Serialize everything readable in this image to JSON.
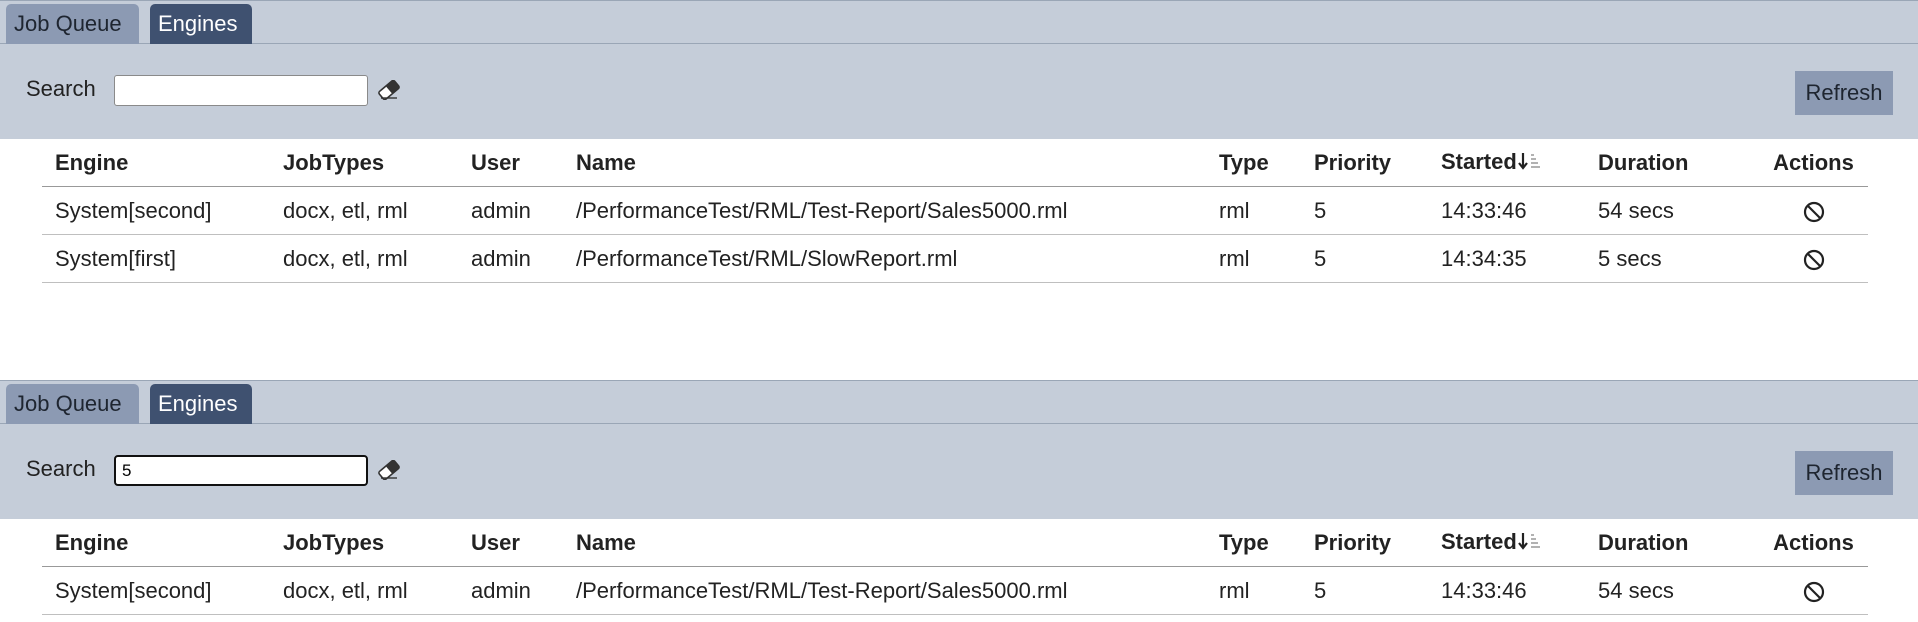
{
  "panels": [
    {
      "tabs": {
        "job_queue": "Job Queue",
        "engines": "Engines"
      },
      "search": {
        "label": "Search",
        "value": ""
      },
      "refresh_label": "Refresh",
      "columns": [
        "Engine",
        "JobTypes",
        "User",
        "Name",
        "Type",
        "Priority",
        "Started",
        "Duration",
        "Actions"
      ],
      "rows": [
        {
          "engine": "System[second]",
          "jobtypes": "docx, etl, rml",
          "user": "admin",
          "name": "/PerformanceTest/RML/Test-Report/Sales5000.rml",
          "type": "rml",
          "priority": "5",
          "started": "14:33:46",
          "duration": "54 secs"
        },
        {
          "engine": "System[first]",
          "jobtypes": "docx, etl, rml",
          "user": "admin",
          "name": "/PerformanceTest/RML/SlowReport.rml",
          "type": "rml",
          "priority": "5",
          "started": "14:34:35",
          "duration": "5 secs"
        }
      ]
    },
    {
      "tabs": {
        "job_queue": "Job Queue",
        "engines": "Engines"
      },
      "search": {
        "label": "Search",
        "value": "5"
      },
      "refresh_label": "Refresh",
      "columns": [
        "Engine",
        "JobTypes",
        "User",
        "Name",
        "Type",
        "Priority",
        "Started",
        "Duration",
        "Actions"
      ],
      "rows": [
        {
          "engine": "System[second]",
          "jobtypes": "docx, etl, rml",
          "user": "admin",
          "name": "/PerformanceTest/RML/Test-Report/Sales5000.rml",
          "type": "rml",
          "priority": "5",
          "started": "14:33:46",
          "duration": "54 secs"
        }
      ]
    }
  ],
  "icons": {
    "clear": "eraser-icon",
    "sort": "sort-descending-icon",
    "cancel": "cancel-job-icon"
  },
  "colors": {
    "panel_bg": "#c5cdd9",
    "active_tab": "#3f5170",
    "inactive_tab": "#8c9ab3",
    "button": "#8c9ab3"
  }
}
